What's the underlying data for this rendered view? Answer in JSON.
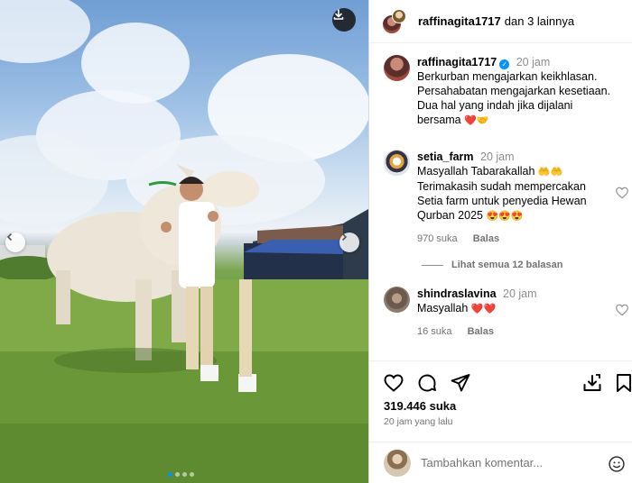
{
  "header": {
    "username": "raffinagita1717",
    "collab_text": "dan 3 lainnya"
  },
  "caption": {
    "username": "raffinagita1717",
    "time": "20 jam",
    "lines": [
      "Berkurban mengajarkan keikhlasan.",
      "Persahabatan mengajarkan kesetiaan.",
      "Dua hal yang indah jika dijalani",
      "bersama"
    ],
    "emoji": "❤️🤝"
  },
  "comments": [
    {
      "username": "setia_farm",
      "time": "20 jam",
      "lines": [
        "Masyallah Tabarakallah",
        "Terimakasih sudah mempercakan",
        "Setia farm untuk penyedia Hewan",
        "Qurban 2025"
      ],
      "emoji_line1": "🤲🤲",
      "emoji_line4": "😍😍😍",
      "likes": "970 suka",
      "reply_label": "Balas"
    },
    {
      "username": "shindraslavina",
      "time": "20 jam",
      "text": "Masyallah",
      "emoji": "❤️❤️",
      "likes": "16 suka",
      "reply_label": "Balas"
    }
  ],
  "view_replies": "Lihat semua 12 balasan",
  "stats": {
    "likes": "319.446 suka",
    "time_ago": "20 jam yang lalu"
  },
  "add_comment": {
    "placeholder": "Tambahkan komentar..."
  },
  "carousel": {
    "slides": 4,
    "active_slide": 1
  },
  "colors": {
    "accent": "#0095f6",
    "heart": "#e0152b"
  },
  "icons": [
    "download-icon",
    "chevron-left-icon",
    "chevron-right-icon",
    "heart-icon",
    "comment-icon",
    "share-icon",
    "save-icon",
    "emoji-icon",
    "verified-icon"
  ]
}
